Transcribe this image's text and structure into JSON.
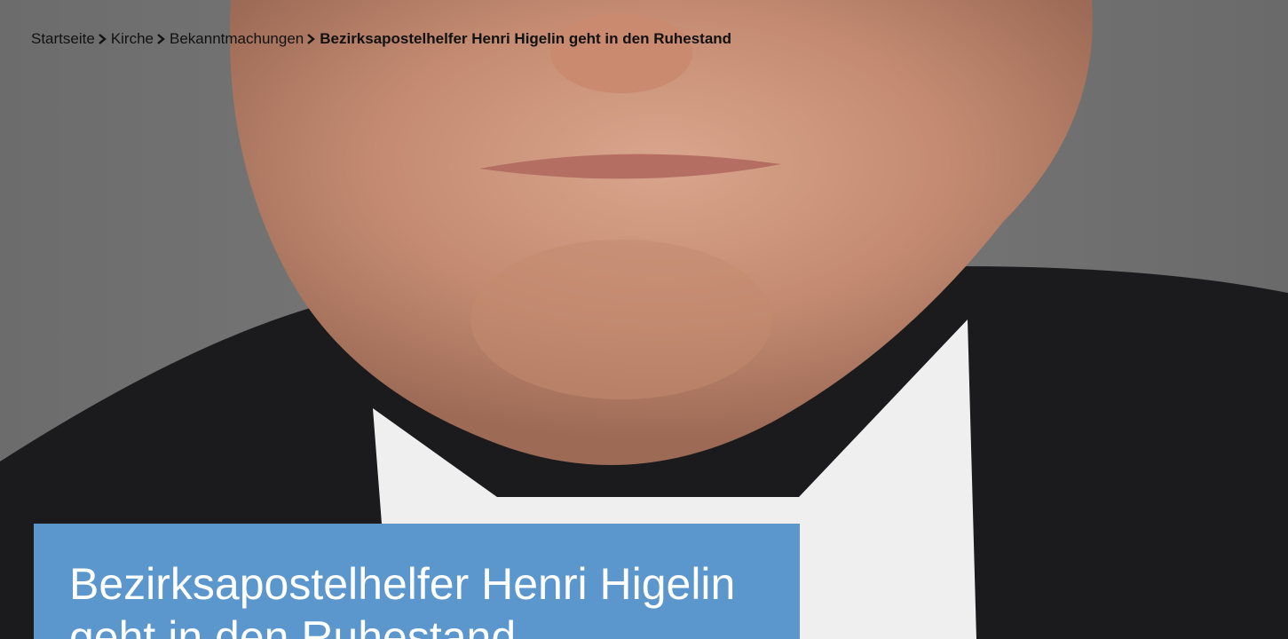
{
  "breadcrumb": {
    "items": [
      "Startseite",
      "Kirche",
      "Bekanntmachungen"
    ],
    "current": "Bezirksapostelhelfer Henri Higelin geht in den Ruhestand",
    "separator_icon": "chevron-right-icon"
  },
  "hero": {
    "title": "Bezirksapostelhelfer Henri Higelin geht in den Ruhestand",
    "title_box_color": "#5b96cc",
    "background_color": "#6e6e6e"
  }
}
